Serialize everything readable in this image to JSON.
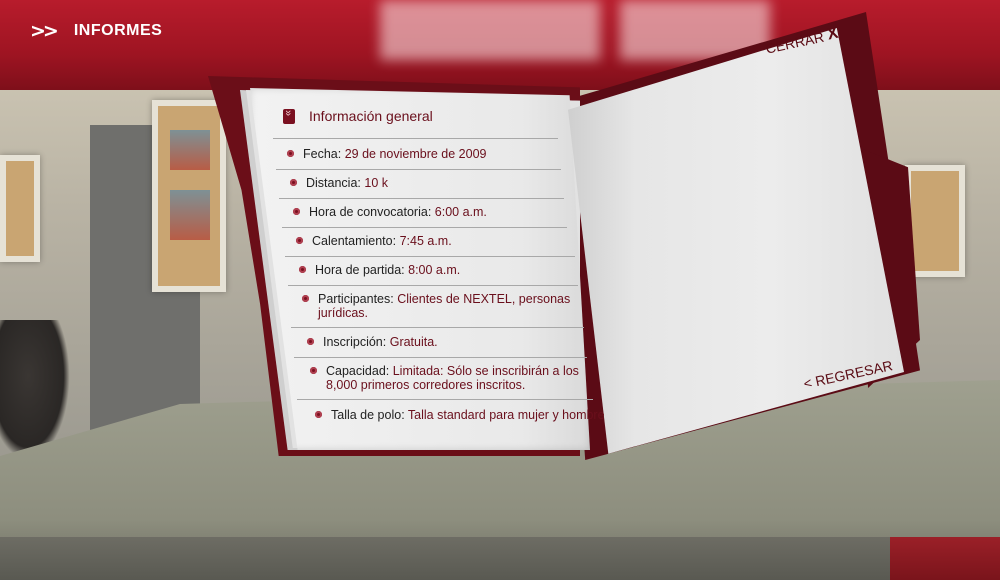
{
  "header": {
    "title": "INFORMES"
  },
  "folder": {
    "close_label": "CERRAR",
    "close_x": "X",
    "back_label": "< REGRESAR",
    "section_title": "Información general",
    "items": [
      {
        "label": "Fecha:",
        "value": "29 de noviembre de 2009"
      },
      {
        "label": "Distancia:",
        "value": "10 k"
      },
      {
        "label": "Hora de convocatoria:",
        "value": "6:00 a.m."
      },
      {
        "label": "Calentamiento:",
        "value": "7:45 a.m."
      },
      {
        "label": "Hora de partida:",
        "value": "8:00 a.m."
      },
      {
        "label": "Participantes:",
        "value": "Clientes de NEXTEL, personas",
        "value2": "jurídicas."
      },
      {
        "label": "Inscripción:",
        "value": "Gratuita."
      },
      {
        "label": "Capacidad:",
        "value": "Limitada: Sólo se inscribirán a los",
        "value2": "8,000 primeros corredores inscritos."
      },
      {
        "label": "Talla de polo:",
        "value": "Talla standard para mujer y hombre"
      }
    ]
  }
}
